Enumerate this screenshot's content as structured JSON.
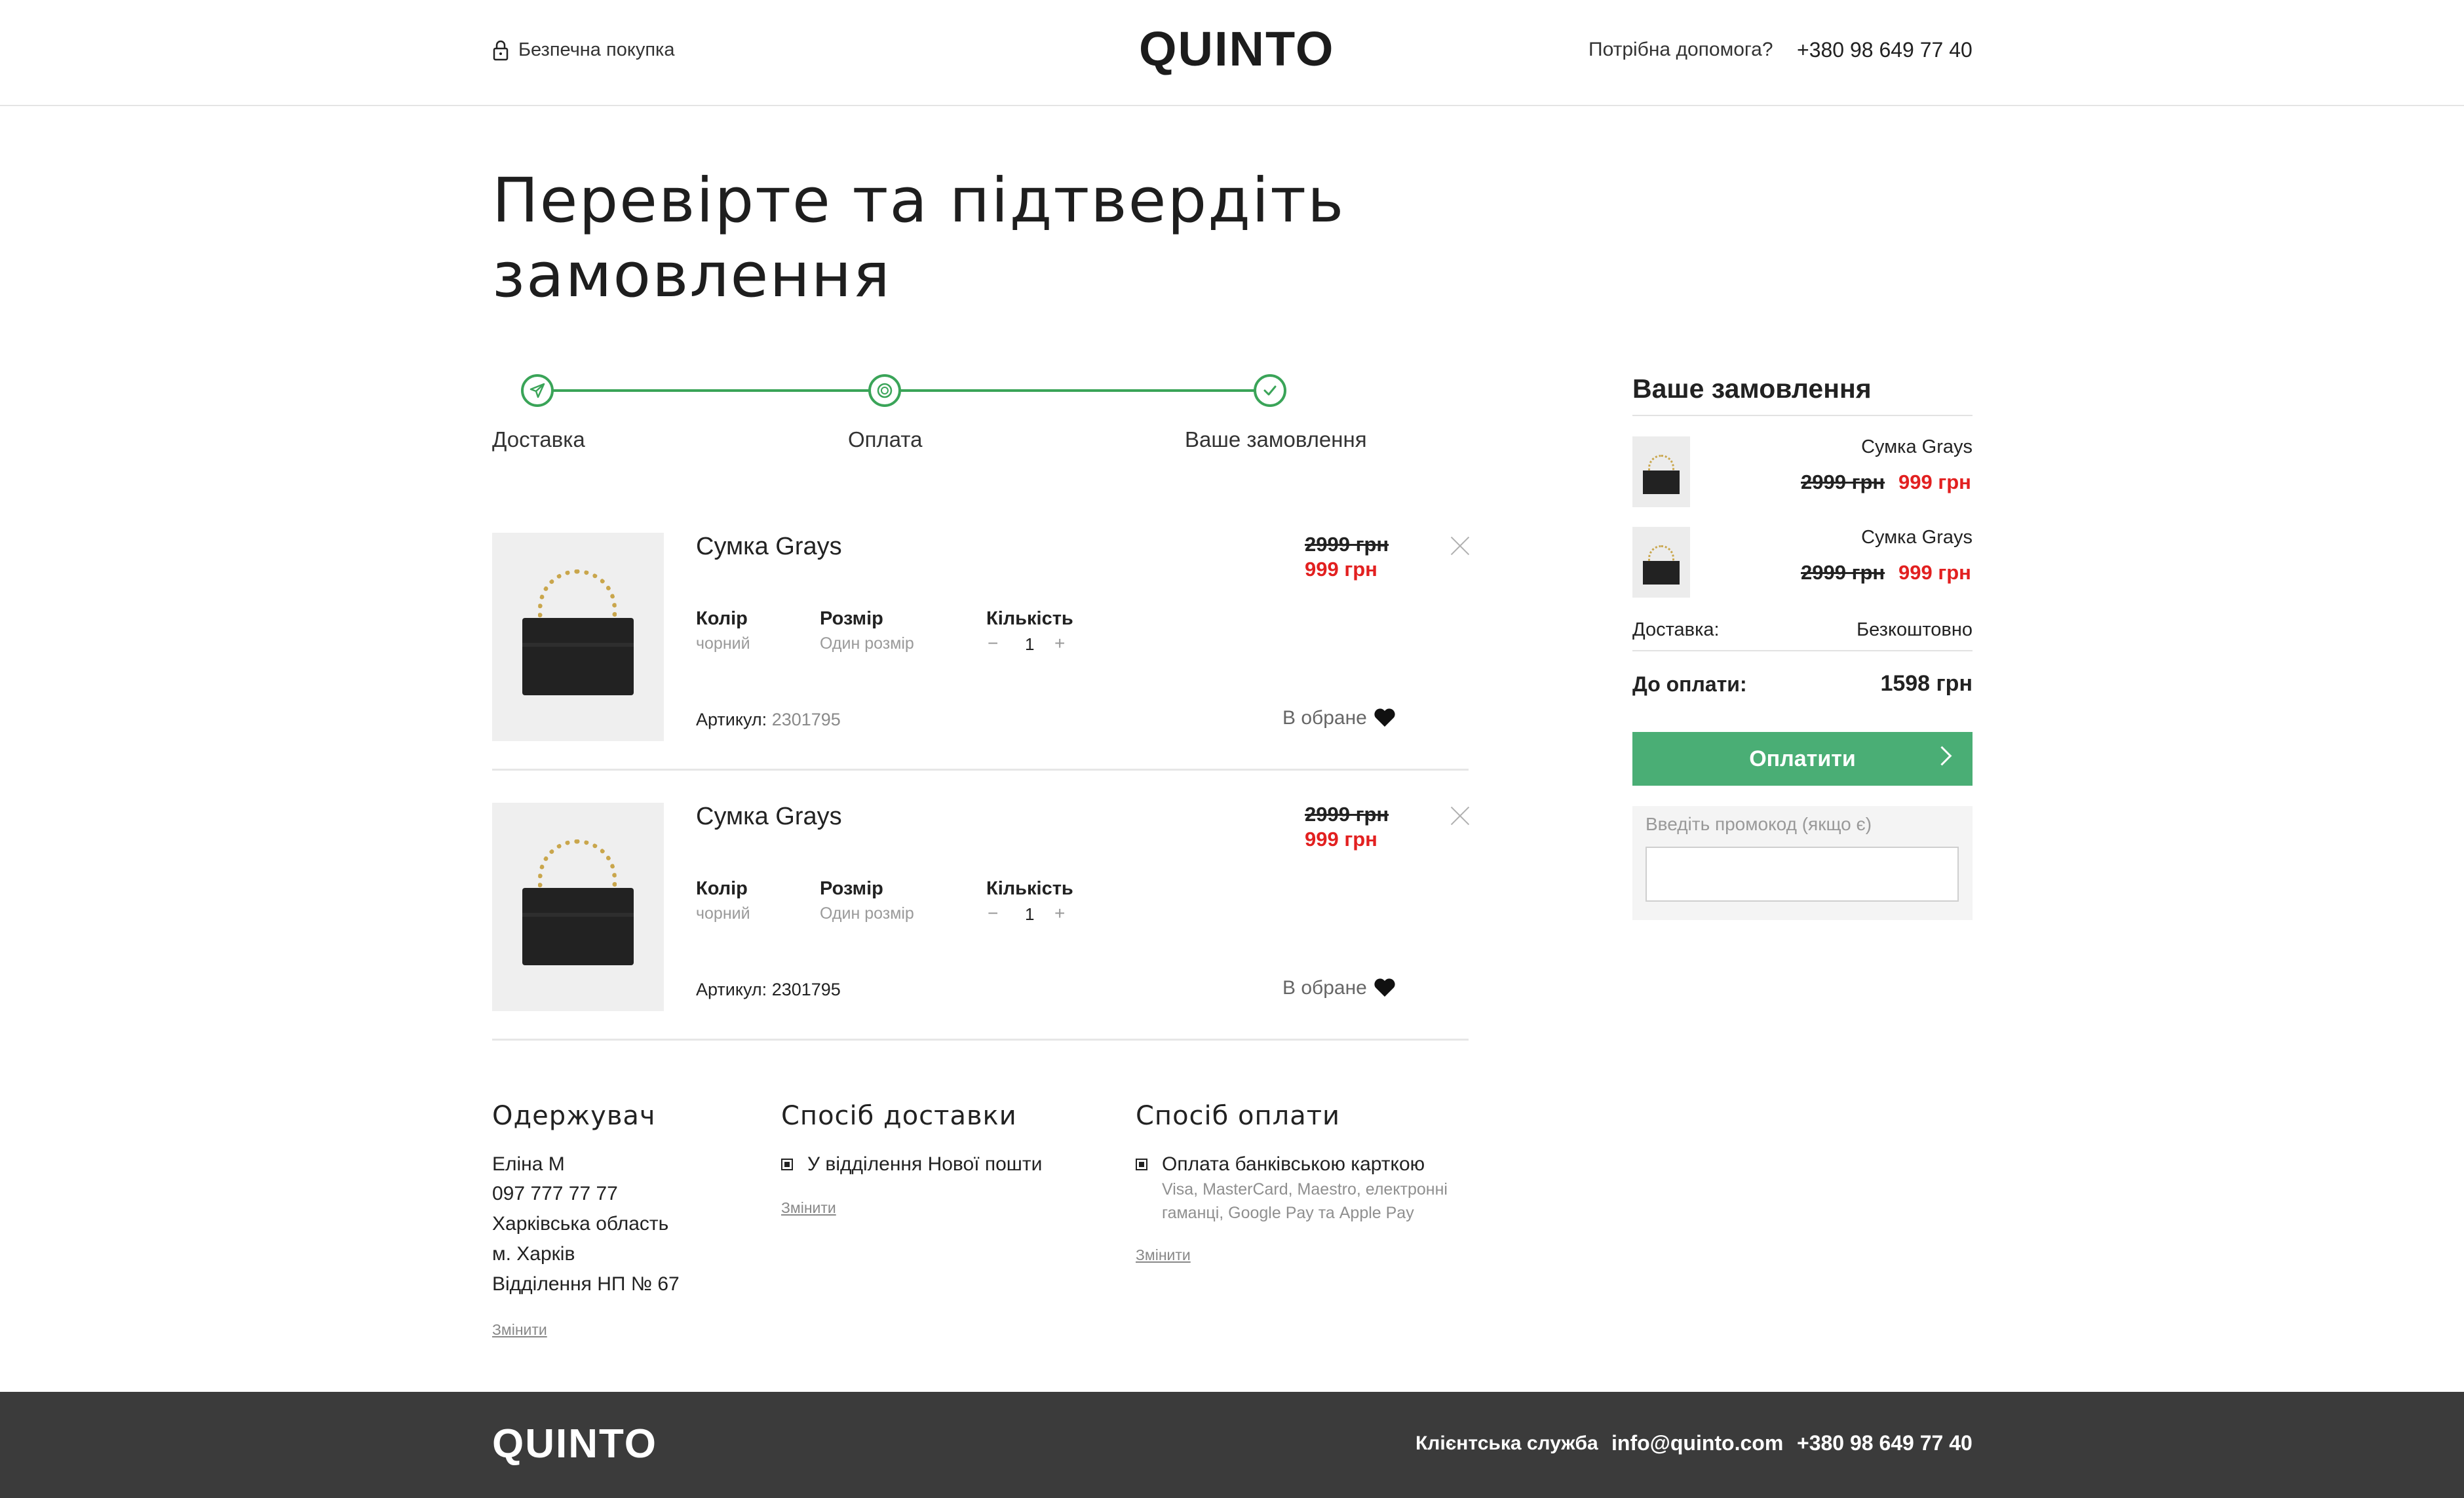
{
  "header": {
    "secure_label": "Безпечна покупка",
    "logo": "QUINTO",
    "help_label": "Потрібна допомога?",
    "phone": "+380 98 649 77 40"
  },
  "page_title": "Перевірте та підтвердіть замовлення",
  "steps": [
    {
      "label": "Доставка",
      "icon": "send-icon"
    },
    {
      "label": "Оплата",
      "icon": "payment-icon"
    },
    {
      "label": "Ваше замовлення",
      "icon": "check-icon"
    }
  ],
  "items": [
    {
      "name": "Сумка Grays",
      "color_label": "Колір",
      "color_value": "чорний",
      "size_label": "Розмір",
      "size_value": "Один розмір",
      "qty_label": "Кількість",
      "qty_minus": "−",
      "qty_value": "1",
      "qty_plus": "+",
      "sku_label": "Артикул:",
      "sku_value": "2301795",
      "old_price": "2999 грн",
      "new_price": "999 грн",
      "fav_label": "В обране"
    },
    {
      "name": "Сумка Grays",
      "color_label": "Колір",
      "color_value": "чорний",
      "size_label": "Розмір",
      "size_value": "Один розмір",
      "qty_label": "Кількість",
      "qty_minus": "−",
      "qty_value": "1",
      "qty_plus": "+",
      "sku_label": "Артикул:",
      "sku_value": "2301795",
      "old_price": "2999 грн",
      "new_price": "999 грн",
      "fav_label": "В обране"
    }
  ],
  "recipient": {
    "heading": "Одержувач",
    "lines": [
      "Еліна М",
      "097 777 77 77",
      "Харківська область",
      "м. Харків",
      "Відділення НП № 67"
    ],
    "change": "Змінити"
  },
  "delivery": {
    "heading": "Спосіб доставки",
    "option": "У відділення Нової пошти",
    "change": "Змінити"
  },
  "payment": {
    "heading": "Спосіб оплати",
    "option": "Оплата банківською карткою",
    "note_line1": "Visa, MasterCard, Maestro, електронні",
    "note_line2": "гаманці, Google Pay та Apple Pay",
    "change": "Змінити"
  },
  "summary": {
    "heading": "Ваше замовлення",
    "items": [
      {
        "name": "Сумка Grays",
        "old_price": "2999 грн",
        "new_price": "999 грн"
      },
      {
        "name": "Сумка Grays",
        "old_price": "2999 грн",
        "new_price": "999 грн"
      }
    ],
    "delivery_label": "Доставка:",
    "delivery_value": "Безкоштовно",
    "total_label": "До оплати:",
    "total_value": "1598 грн",
    "pay_button": "Оплатити",
    "promo_label": "Введіть промокод (якщо є)",
    "promo_value": ""
  },
  "footer": {
    "logo": "QUINTO",
    "service": "Клієнтська служба",
    "email": "info@quinto.com",
    "phone": "+380 98 649 77 40"
  },
  "colors": {
    "accent_green": "#3aa458",
    "button_green": "#4aae75",
    "sale_red": "#e22020",
    "footer_bg": "#3b3b3b"
  }
}
